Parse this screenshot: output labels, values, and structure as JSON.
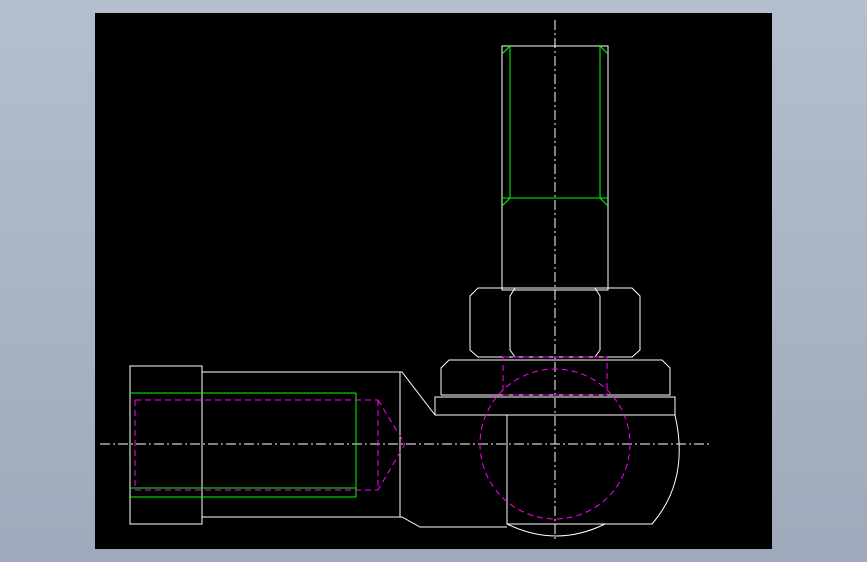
{
  "colors": {
    "background": "#000000",
    "outline": "#ffffff",
    "thread": "#00ff00",
    "hidden": "#ff00ff",
    "centerline": "#ffffff"
  },
  "views": {
    "front": "rod-end-front-view",
    "side": "rod-end-side-view"
  }
}
